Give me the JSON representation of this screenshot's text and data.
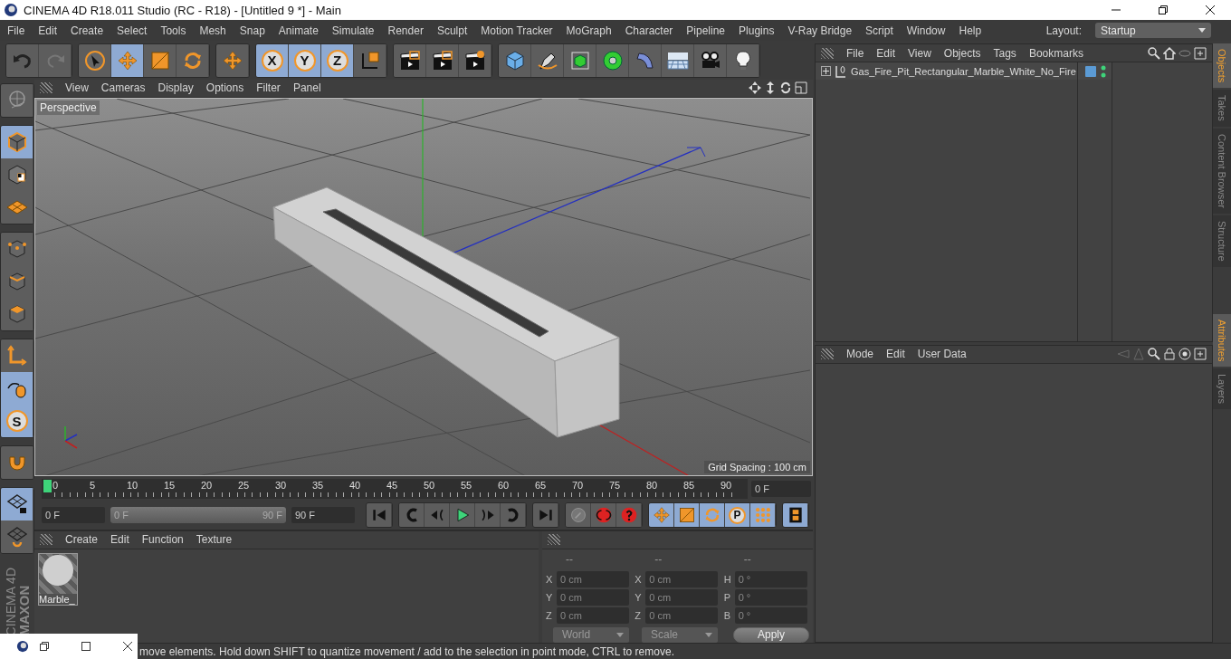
{
  "window": {
    "title": "CINEMA 4D R18.011 Studio (RC - R18) - [Untitled 9 *] - Main"
  },
  "menu": [
    "File",
    "Edit",
    "Create",
    "Select",
    "Tools",
    "Mesh",
    "Snap",
    "Animate",
    "Simulate",
    "Render",
    "Sculpt",
    "Motion Tracker",
    "MoGraph",
    "Character",
    "Pipeline",
    "Plugins",
    "V-Ray Bridge",
    "Script",
    "Window",
    "Help"
  ],
  "layout": {
    "label": "Layout:",
    "value": "Startup"
  },
  "toolbar": [
    {
      "items": [
        {
          "kind": "undo",
          "selected": false
        },
        {
          "kind": "redo",
          "selected": false
        }
      ]
    },
    {
      "items": [
        {
          "kind": "select",
          "selected": false
        },
        {
          "kind": "move",
          "selected": true
        },
        {
          "kind": "scale",
          "selected": false
        },
        {
          "kind": "rotate",
          "selected": false
        }
      ]
    },
    {
      "items": [
        {
          "kind": "move",
          "selected": false
        }
      ]
    },
    {
      "items": [
        {
          "kind": "letter",
          "label": "X",
          "selected": true
        },
        {
          "kind": "letter",
          "label": "Y",
          "selected": true
        },
        {
          "kind": "letter",
          "label": "Z",
          "selected": true
        },
        {
          "kind": "coords",
          "selected": false
        }
      ]
    },
    {
      "items": [
        {
          "kind": "clapper",
          "selected": false
        },
        {
          "kind": "clapper",
          "selected": false
        },
        {
          "kind": "clapper-gear",
          "selected": false
        }
      ]
    },
    {
      "items": [
        {
          "kind": "cube",
          "selected": false
        },
        {
          "kind": "pen",
          "selected": false
        },
        {
          "kind": "cage",
          "selected": false
        },
        {
          "kind": "flower",
          "selected": false
        },
        {
          "kind": "bend",
          "selected": false
        },
        {
          "kind": "floor",
          "selected": false
        },
        {
          "kind": "camera",
          "selected": false
        },
        {
          "kind": "light",
          "selected": false
        }
      ]
    }
  ],
  "left_tools": [
    {
      "items": [
        {
          "kind": "globe",
          "selected": false
        }
      ]
    },
    {
      "items": [
        {
          "kind": "model",
          "selected": true
        },
        {
          "kind": "texture",
          "selected": false
        },
        {
          "kind": "plane",
          "selected": false
        }
      ]
    },
    {
      "items": [
        {
          "kind": "points",
          "selected": false
        },
        {
          "kind": "edges",
          "selected": false
        },
        {
          "kind": "polygons",
          "selected": false
        }
      ]
    },
    {
      "items": [
        {
          "kind": "axis",
          "selected": false
        },
        {
          "kind": "mouse",
          "selected": true
        },
        {
          "kind": "letter",
          "label": "S",
          "selected": true
        }
      ]
    },
    {
      "items": [
        {
          "kind": "magnet",
          "selected": false
        }
      ]
    },
    {
      "items": [
        {
          "kind": "grid-lock",
          "selected": true
        },
        {
          "kind": "grid-rotate",
          "selected": false
        }
      ]
    }
  ],
  "brand": {
    "company": "MAXON",
    "product": "CINEMA 4D"
  },
  "viewport": {
    "menu": [
      "View",
      "Cameras",
      "Display",
      "Options",
      "Filter",
      "Panel"
    ],
    "camera": "Perspective",
    "grid_spacing": "Grid Spacing : 100 cm"
  },
  "timeline": {
    "ticks": [
      "0",
      "5",
      "10",
      "15",
      "20",
      "25",
      "30",
      "35",
      "40",
      "45",
      "50",
      "55",
      "60",
      "65",
      "70",
      "75",
      "80",
      "85",
      "90"
    ],
    "playhead": {
      "level": 0
    },
    "current": "0 F"
  },
  "transport": {
    "start": "0 F",
    "range": {
      "start": "0 F",
      "end": "90 F",
      "level": 1
    },
    "end": "90 F",
    "groups": [
      {
        "items": [
          {
            "kind": "first",
            "selected": false
          }
        ]
      },
      {
        "items": [
          {
            "kind": "prev-key",
            "selected": false
          },
          {
            "kind": "prev-frame",
            "selected": false
          },
          {
            "kind": "play",
            "selected": false
          },
          {
            "kind": "next-frame",
            "selected": false
          },
          {
            "kind": "next-key",
            "selected": false
          }
        ]
      },
      {
        "items": [
          {
            "kind": "last",
            "selected": false
          }
        ]
      },
      {
        "items": [
          {
            "kind": "key",
            "selected": false
          },
          {
            "kind": "record",
            "selected": false
          },
          {
            "kind": "autokey",
            "selected": false
          }
        ]
      },
      {
        "items": [
          {
            "kind": "move",
            "selected": true
          },
          {
            "kind": "scale",
            "selected": true
          },
          {
            "kind": "rotate",
            "selected": true
          },
          {
            "kind": "letter",
            "label": "P",
            "selected": true
          },
          {
            "kind": "dots",
            "selected": true
          }
        ]
      },
      {
        "items": [
          {
            "kind": "film",
            "selected": true
          }
        ]
      }
    ]
  },
  "materials": {
    "menu": [
      "Create",
      "Edit",
      "Function",
      "Texture"
    ],
    "items": [
      {
        "name": "Marble_"
      }
    ]
  },
  "coordinates": {
    "columns": [
      {
        "header": "--",
        "fields": [
          {
            "label": "X",
            "value": "0 cm"
          },
          {
            "label": "Y",
            "value": "0 cm"
          },
          {
            "label": "Z",
            "value": "0 cm"
          }
        ]
      },
      {
        "header": "--",
        "fields": [
          {
            "label": "X",
            "value": "0 cm"
          },
          {
            "label": "Y",
            "value": "0 cm"
          },
          {
            "label": "Z",
            "value": "0 cm"
          }
        ]
      },
      {
        "header": "--",
        "fields": [
          {
            "label": "H",
            "value": "0 °"
          },
          {
            "label": "P",
            "value": "0 °"
          },
          {
            "label": "B",
            "value": "0 °"
          }
        ]
      }
    ],
    "space": "World",
    "mode": "Scale",
    "apply": "Apply"
  },
  "objects": {
    "menu": [
      "File",
      "Edit",
      "View",
      "Objects",
      "Tags",
      "Bookmarks"
    ],
    "items": [
      {
        "name": "Gas_Fire_Pit_Rectangular_Marble_White_No_Fire",
        "expanded": false
      }
    ]
  },
  "attributes": {
    "menu": [
      "Mode",
      "Edit",
      "User Data"
    ]
  },
  "side_tabs_top": [
    {
      "label": "Objects",
      "selected": true
    },
    {
      "label": "Takes",
      "selected": false
    },
    {
      "label": "Content Browser",
      "selected": false
    },
    {
      "label": "Structure",
      "selected": false
    }
  ],
  "side_tabs_bottom": [
    {
      "label": "Attributes",
      "selected": true
    },
    {
      "label": "Layers",
      "selected": false
    }
  ],
  "status": "move elements. Hold down SHIFT to quantize movement / add to the selection in point mode, CTRL to remove."
}
